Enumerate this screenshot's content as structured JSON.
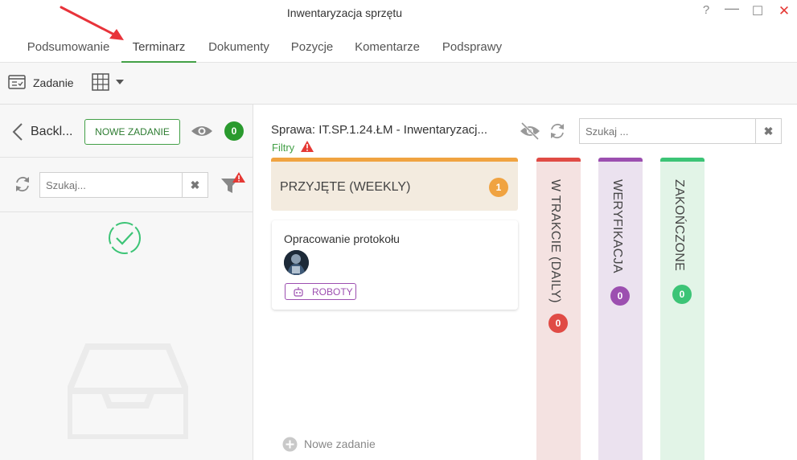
{
  "window": {
    "title": "Inwentaryzacja sprzętu",
    "help": "?",
    "minimize": "—",
    "maximize": "☐",
    "close": "✕"
  },
  "tabs": [
    {
      "label": "Podsumowanie"
    },
    {
      "label": "Terminarz"
    },
    {
      "label": "Dokumenty"
    },
    {
      "label": "Pozycje"
    },
    {
      "label": "Komentarze"
    },
    {
      "label": "Podsprawy"
    }
  ],
  "active_tab": "Terminarz",
  "toolbar": {
    "task_label": "Zadanie"
  },
  "left_panel": {
    "back_label": "Backl...",
    "new_task_button": "NOWE ZADANIE",
    "count": "0",
    "search_placeholder": "Szukaj...",
    "clear": "✖"
  },
  "board": {
    "case_title": "Sprawa: IT.SP.1.24.ŁM - Inwentaryzacj...",
    "filters_label": "Filtry",
    "search_placeholder": "Szukaj ...",
    "clear": "✖",
    "columns": [
      {
        "label": "PRZYJĘTE (WEEKLY)",
        "count": "1",
        "accent": "#f0a341",
        "bg": "#f3ebdf"
      },
      {
        "label": "W TRAKCIE (DAILY)",
        "count": "0",
        "accent": "#e04b45",
        "bg": "#f4e2e1"
      },
      {
        "label": "WERYFIKACJA",
        "count": "0",
        "accent": "#9c4fb0",
        "bg": "#ebe2ef"
      },
      {
        "label": "ZAKOŃCZONE",
        "count": "0",
        "accent": "#3cc476",
        "bg": "#e2f4e7"
      }
    ],
    "card": {
      "title": "Opracowanie protokołu",
      "tag": "ROBOTY"
    },
    "add_task_label": "Nowe zadanie"
  },
  "colors": {
    "accent_green": "#43a047",
    "badge_green": "#2a9a2e",
    "alert_red": "#e53935",
    "arrow_red": "#e8333a"
  }
}
